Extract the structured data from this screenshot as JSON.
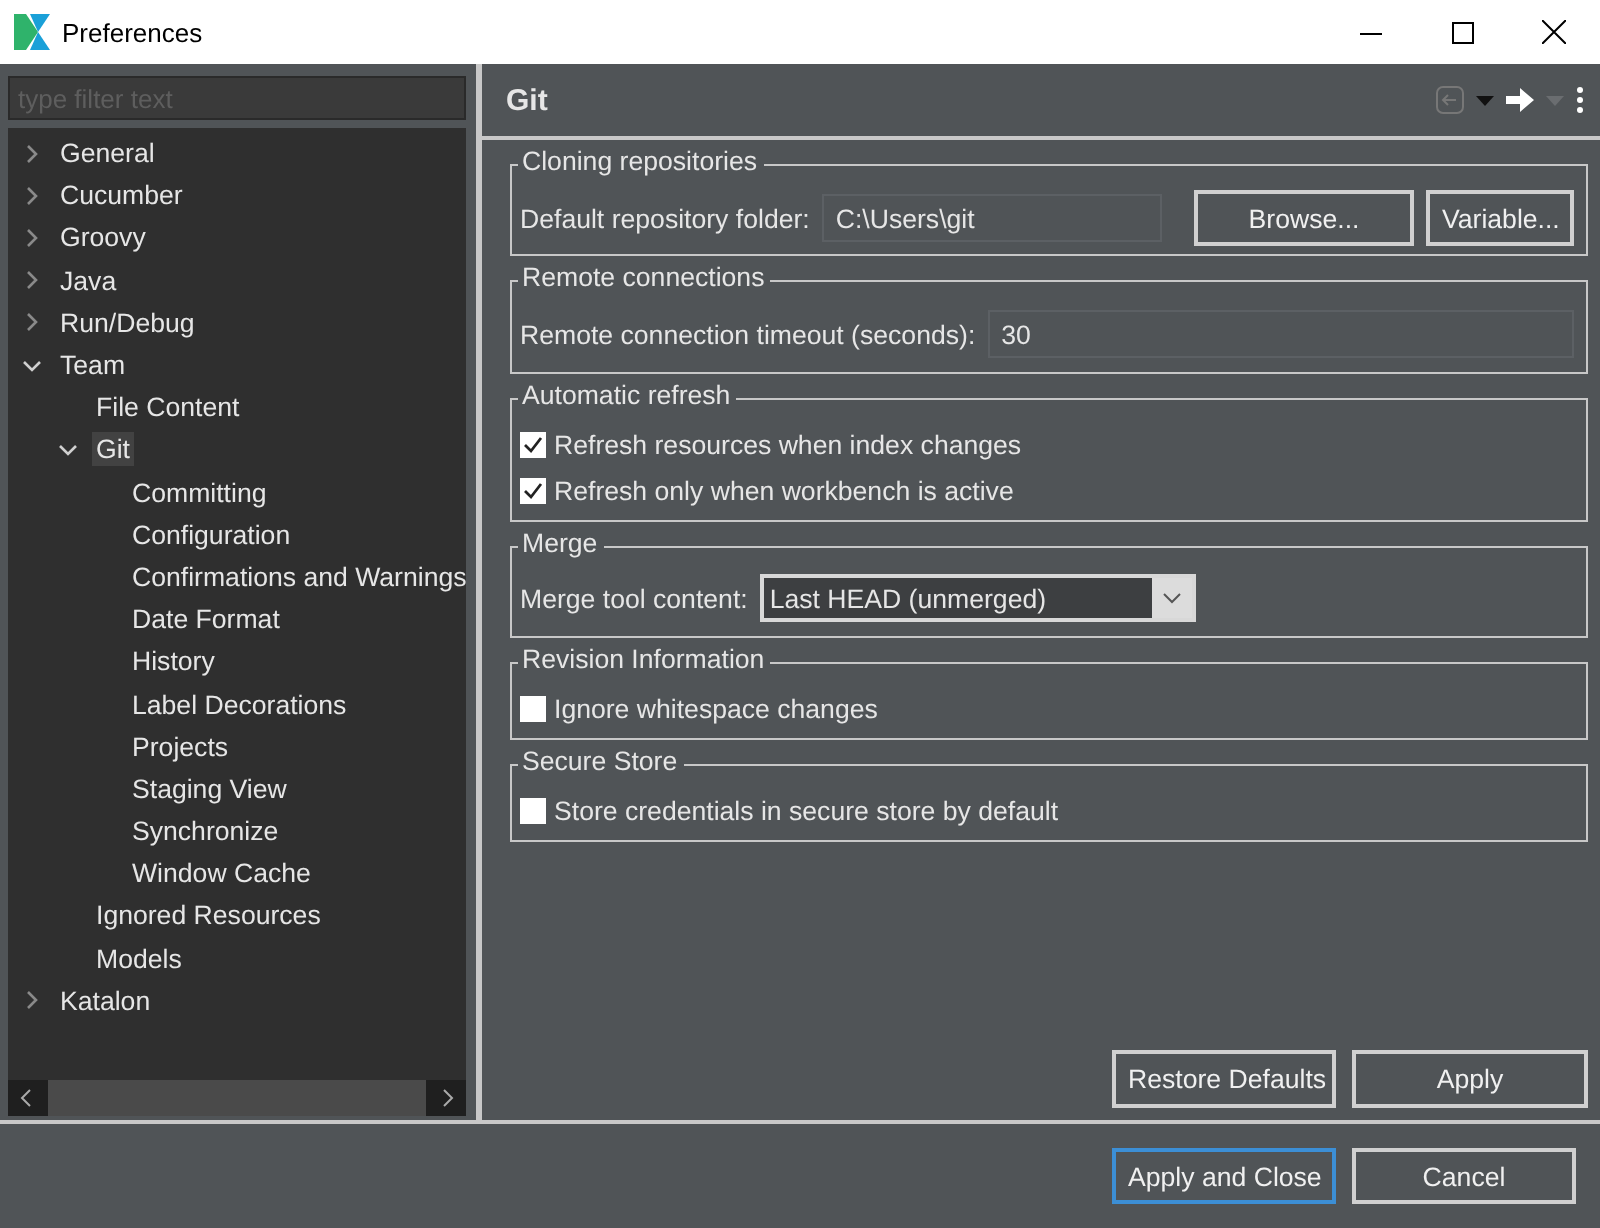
{
  "window": {
    "title": "Preferences"
  },
  "filter": {
    "placeholder": "type filter text"
  },
  "tree": [
    {
      "label": "General",
      "expanded": false,
      "selected": false
    },
    {
      "label": "Cucumber",
      "expanded": false,
      "selected": false
    },
    {
      "label": "Groovy",
      "expanded": false,
      "selected": false
    },
    {
      "label": "Java",
      "expanded": false,
      "selected": false
    },
    {
      "label": "Run/Debug",
      "expanded": false,
      "selected": false
    },
    {
      "label": "Team",
      "expanded": true,
      "selected": false,
      "children": [
        {
          "label": "File Content",
          "selected": false
        },
        {
          "label": "Git",
          "expanded": true,
          "selected": true,
          "children": [
            {
              "label": "Committing",
              "selected": false
            },
            {
              "label": "Configuration",
              "selected": false
            },
            {
              "label": "Confirmations and Warnings",
              "selected": false
            },
            {
              "label": "Date Format",
              "selected": false
            },
            {
              "label": "History",
              "selected": false
            },
            {
              "label": "Label Decorations",
              "selected": false
            },
            {
              "label": "Projects",
              "selected": false
            },
            {
              "label": "Staging View",
              "selected": false
            },
            {
              "label": "Synchronize",
              "selected": false
            },
            {
              "label": "Window Cache",
              "selected": false
            }
          ]
        },
        {
          "label": "Ignored Resources",
          "selected": false
        },
        {
          "label": "Models",
          "selected": false
        }
      ]
    },
    {
      "label": "Katalon",
      "expanded": false,
      "selected": false
    }
  ],
  "page": {
    "title": "Git"
  },
  "groups": [
    {
      "title": "Cloning repositories",
      "controls": [
        {
          "kind": "path",
          "label": "Default repository folder:",
          "value": "C:\\Users\\git",
          "buttons": [
            "Browse...",
            "Variable..."
          ]
        }
      ]
    },
    {
      "title": "Remote connections",
      "controls": [
        {
          "kind": "text",
          "label": "Remote connection timeout (seconds):",
          "value": "30"
        }
      ]
    },
    {
      "title": "Automatic refresh",
      "controls": [
        {
          "kind": "checkbox",
          "label": "Refresh resources when index changes",
          "checked": true
        },
        {
          "kind": "checkbox",
          "label": "Refresh only when workbench is active",
          "checked": true
        }
      ]
    },
    {
      "title": "Merge",
      "controls": [
        {
          "kind": "select",
          "label": "Merge tool content:",
          "value": "Last HEAD (unmerged)"
        }
      ]
    },
    {
      "title": "Revision Information",
      "controls": [
        {
          "kind": "checkbox",
          "label": "Ignore whitespace changes",
          "checked": false
        }
      ]
    },
    {
      "title": "Secure Store",
      "controls": [
        {
          "kind": "checkbox",
          "label": "Store credentials in secure store by default",
          "checked": false
        }
      ]
    }
  ],
  "page_buttons": [
    "Restore Defaults",
    "Apply"
  ],
  "dialog_buttons": [
    {
      "label": "Apply and Close",
      "default": true
    },
    {
      "label": "Cancel",
      "default": false
    }
  ]
}
